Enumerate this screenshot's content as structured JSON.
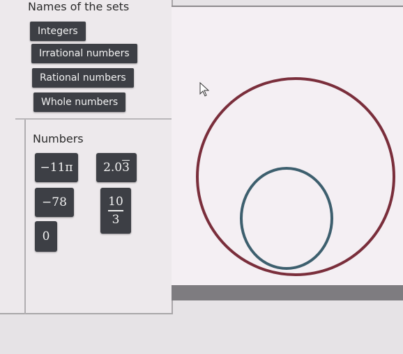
{
  "sets": {
    "title": "Names of the sets",
    "items": [
      {
        "label": "Integers"
      },
      {
        "label": "Irrational numbers"
      },
      {
        "label": "Rational numbers"
      },
      {
        "label": "Whole numbers"
      }
    ]
  },
  "numbers": {
    "title": "Numbers",
    "neg11pi": "−11π",
    "repeating_whole": "2.0",
    "repeating_digit": "3",
    "neg78": "−78",
    "frac_num": "10",
    "frac_den": "3",
    "zero": "0"
  },
  "diagram": {
    "outer_color": "#7a2e3b",
    "inner_color": "#3d5f6e"
  }
}
